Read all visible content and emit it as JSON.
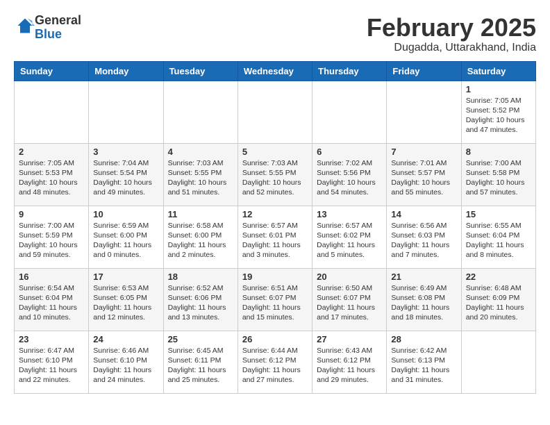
{
  "logo": {
    "general": "General",
    "blue": "Blue"
  },
  "header": {
    "month": "February 2025",
    "location": "Dugadda, Uttarakhand, India"
  },
  "weekdays": [
    "Sunday",
    "Monday",
    "Tuesday",
    "Wednesday",
    "Thursday",
    "Friday",
    "Saturday"
  ],
  "weeks": [
    [
      {
        "day": "",
        "info": ""
      },
      {
        "day": "",
        "info": ""
      },
      {
        "day": "",
        "info": ""
      },
      {
        "day": "",
        "info": ""
      },
      {
        "day": "",
        "info": ""
      },
      {
        "day": "",
        "info": ""
      },
      {
        "day": "1",
        "info": "Sunrise: 7:05 AM\nSunset: 5:52 PM\nDaylight: 10 hours and 47 minutes."
      }
    ],
    [
      {
        "day": "2",
        "info": "Sunrise: 7:05 AM\nSunset: 5:53 PM\nDaylight: 10 hours and 48 minutes."
      },
      {
        "day": "3",
        "info": "Sunrise: 7:04 AM\nSunset: 5:54 PM\nDaylight: 10 hours and 49 minutes."
      },
      {
        "day": "4",
        "info": "Sunrise: 7:03 AM\nSunset: 5:55 PM\nDaylight: 10 hours and 51 minutes."
      },
      {
        "day": "5",
        "info": "Sunrise: 7:03 AM\nSunset: 5:55 PM\nDaylight: 10 hours and 52 minutes."
      },
      {
        "day": "6",
        "info": "Sunrise: 7:02 AM\nSunset: 5:56 PM\nDaylight: 10 hours and 54 minutes."
      },
      {
        "day": "7",
        "info": "Sunrise: 7:01 AM\nSunset: 5:57 PM\nDaylight: 10 hours and 55 minutes."
      },
      {
        "day": "8",
        "info": "Sunrise: 7:00 AM\nSunset: 5:58 PM\nDaylight: 10 hours and 57 minutes."
      }
    ],
    [
      {
        "day": "9",
        "info": "Sunrise: 7:00 AM\nSunset: 5:59 PM\nDaylight: 10 hours and 59 minutes."
      },
      {
        "day": "10",
        "info": "Sunrise: 6:59 AM\nSunset: 6:00 PM\nDaylight: 11 hours and 0 minutes."
      },
      {
        "day": "11",
        "info": "Sunrise: 6:58 AM\nSunset: 6:00 PM\nDaylight: 11 hours and 2 minutes."
      },
      {
        "day": "12",
        "info": "Sunrise: 6:57 AM\nSunset: 6:01 PM\nDaylight: 11 hours and 3 minutes."
      },
      {
        "day": "13",
        "info": "Sunrise: 6:57 AM\nSunset: 6:02 PM\nDaylight: 11 hours and 5 minutes."
      },
      {
        "day": "14",
        "info": "Sunrise: 6:56 AM\nSunset: 6:03 PM\nDaylight: 11 hours and 7 minutes."
      },
      {
        "day": "15",
        "info": "Sunrise: 6:55 AM\nSunset: 6:04 PM\nDaylight: 11 hours and 8 minutes."
      }
    ],
    [
      {
        "day": "16",
        "info": "Sunrise: 6:54 AM\nSunset: 6:04 PM\nDaylight: 11 hours and 10 minutes."
      },
      {
        "day": "17",
        "info": "Sunrise: 6:53 AM\nSunset: 6:05 PM\nDaylight: 11 hours and 12 minutes."
      },
      {
        "day": "18",
        "info": "Sunrise: 6:52 AM\nSunset: 6:06 PM\nDaylight: 11 hours and 13 minutes."
      },
      {
        "day": "19",
        "info": "Sunrise: 6:51 AM\nSunset: 6:07 PM\nDaylight: 11 hours and 15 minutes."
      },
      {
        "day": "20",
        "info": "Sunrise: 6:50 AM\nSunset: 6:07 PM\nDaylight: 11 hours and 17 minutes."
      },
      {
        "day": "21",
        "info": "Sunrise: 6:49 AM\nSunset: 6:08 PM\nDaylight: 11 hours and 18 minutes."
      },
      {
        "day": "22",
        "info": "Sunrise: 6:48 AM\nSunset: 6:09 PM\nDaylight: 11 hours and 20 minutes."
      }
    ],
    [
      {
        "day": "23",
        "info": "Sunrise: 6:47 AM\nSunset: 6:10 PM\nDaylight: 11 hours and 22 minutes."
      },
      {
        "day": "24",
        "info": "Sunrise: 6:46 AM\nSunset: 6:10 PM\nDaylight: 11 hours and 24 minutes."
      },
      {
        "day": "25",
        "info": "Sunrise: 6:45 AM\nSunset: 6:11 PM\nDaylight: 11 hours and 25 minutes."
      },
      {
        "day": "26",
        "info": "Sunrise: 6:44 AM\nSunset: 6:12 PM\nDaylight: 11 hours and 27 minutes."
      },
      {
        "day": "27",
        "info": "Sunrise: 6:43 AM\nSunset: 6:12 PM\nDaylight: 11 hours and 29 minutes."
      },
      {
        "day": "28",
        "info": "Sunrise: 6:42 AM\nSunset: 6:13 PM\nDaylight: 11 hours and 31 minutes."
      },
      {
        "day": "",
        "info": ""
      }
    ]
  ]
}
